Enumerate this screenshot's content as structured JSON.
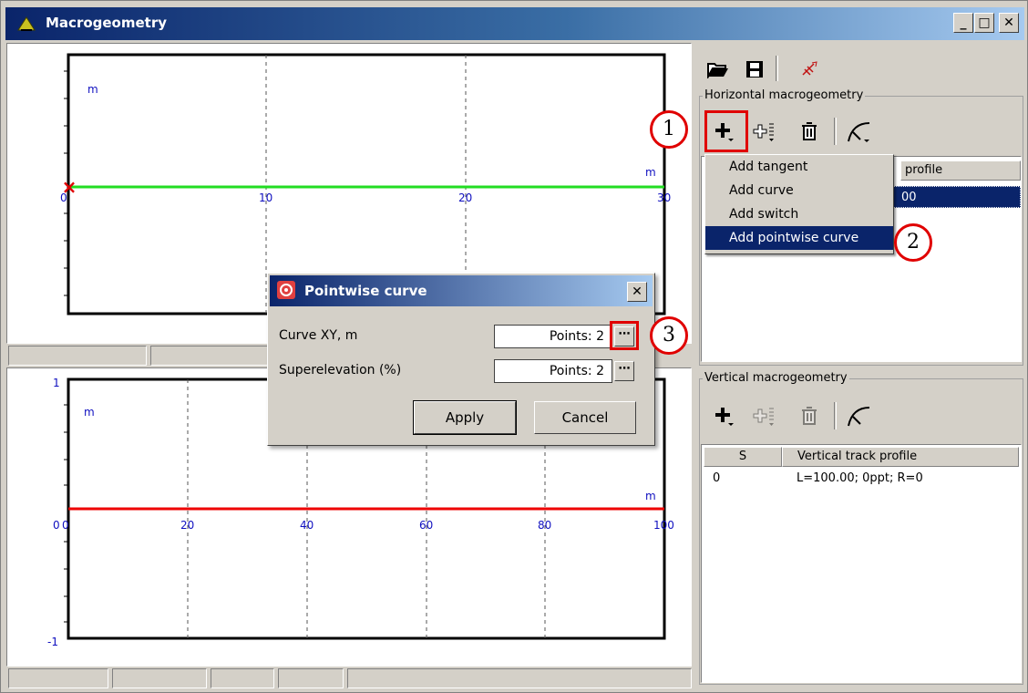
{
  "window": {
    "title": "Macrogeometry",
    "controls": {
      "minimize": "_",
      "maximize": "□",
      "close": "✕"
    }
  },
  "top_plot": {
    "y_unit": "m",
    "x_unit": "m",
    "x_ticks": [
      "0",
      "10",
      "20",
      "30"
    ],
    "line_color": "#22dd22",
    "marker": "×"
  },
  "bottom_plot": {
    "y_unit": "m",
    "x_unit": "m",
    "y_ticks": [
      "1",
      "0",
      "-1"
    ],
    "x_ticks": [
      "0",
      "20",
      "40",
      "60",
      "80",
      "100"
    ],
    "line_color": "#ee0000"
  },
  "toolbar": {
    "open_icon": "folder-open-icon",
    "save_icon": "save-icon",
    "export_icon": "track-export-icon"
  },
  "horizontal": {
    "group_label": "Horizontal macrogeometry",
    "table_header_visible": "profile",
    "row_value": "00",
    "menu": [
      "Add tangent",
      "Add curve",
      "Add switch",
      "Add pointwise curve"
    ],
    "selected_menu_index": 3
  },
  "vertical": {
    "group_label": "Vertical macrogeometry",
    "columns": [
      "S",
      "Vertical track profile"
    ],
    "rows": [
      {
        "s": "0",
        "profile": "L=100.00; 0ppt; R=0"
      }
    ]
  },
  "dialog": {
    "title": "Pointwise curve",
    "fields": [
      {
        "label": "Curve XY, m",
        "value": "Points: 2"
      },
      {
        "label": "Superelevation (%)",
        "value": "Points: 2"
      }
    ],
    "apply": "Apply",
    "cancel": "Cancel",
    "close": "✕"
  },
  "callouts": [
    "1",
    "2",
    "3"
  ],
  "colors": {
    "accent_red": "#e00000",
    "selection": "#0a246a"
  }
}
